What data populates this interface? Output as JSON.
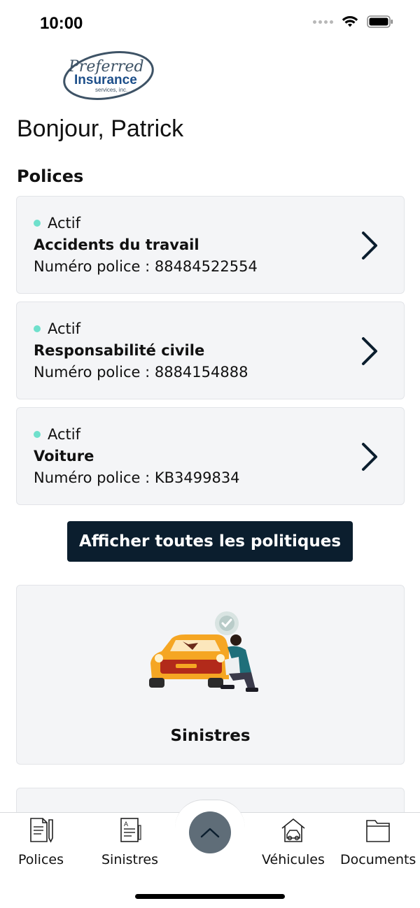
{
  "status_bar": {
    "time": "10:00",
    "icons": [
      "signal-dots-icon",
      "wifi-icon",
      "battery-icon"
    ]
  },
  "logo": {
    "line1": "Preferred",
    "line2": "Insurance",
    "line3": "services, inc."
  },
  "greeting": "Bonjour, Patrick",
  "policies_section": {
    "title": "Polices",
    "items": [
      {
        "status": "Actif",
        "name": "Accidents du travail",
        "number_label": "Numéro police : ",
        "number": "88484522554"
      },
      {
        "status": "Actif",
        "name": "Responsabilité civile",
        "number_label": "Numéro police : ",
        "number": "8884154888"
      },
      {
        "status": "Actif",
        "name": "Voiture",
        "number_label": "Numéro police : ",
        "number": "KB3499834"
      }
    ],
    "view_all_label": "Afficher toutes les politiques"
  },
  "claims_card": {
    "label": "Sinistres",
    "illustration": "damaged-car-with-adjuster"
  },
  "tab_bar": {
    "items": [
      {
        "label": "Polices",
        "icon": "document-pen-icon"
      },
      {
        "label": "Sinistres",
        "icon": "claim-form-icon"
      },
      {
        "label": "Véhicules",
        "icon": "car-garage-icon"
      },
      {
        "label": "Documents",
        "icon": "folder-icon"
      }
    ],
    "center_button_icon": "chevron-up-icon"
  },
  "colors": {
    "accent_dark": "#0b1e2e",
    "status_active": "#6fe0cc",
    "card_bg": "#f4f5f7",
    "fab_bg": "#5f6d78"
  }
}
